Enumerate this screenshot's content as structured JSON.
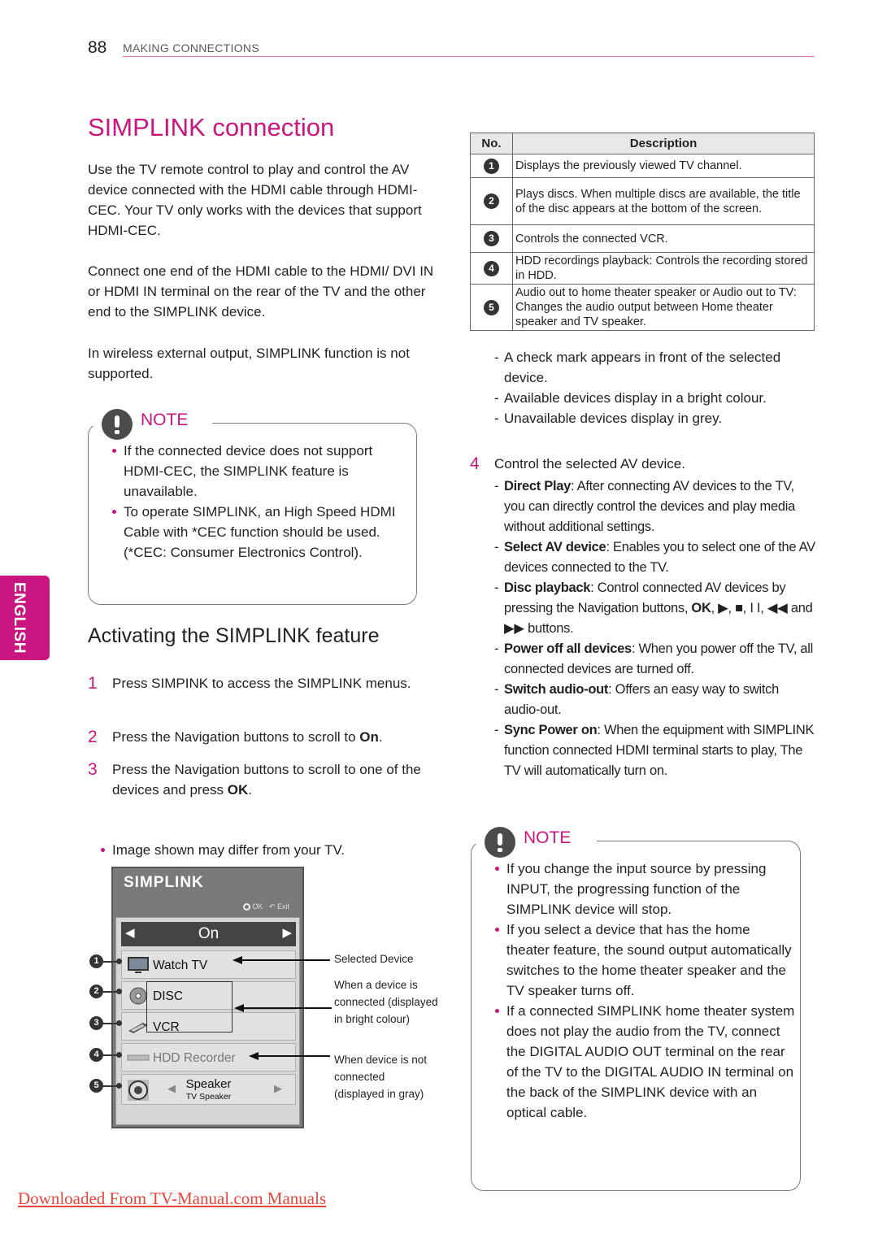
{
  "header": {
    "page_number": "88",
    "section": "MAKING CONNECTIONS"
  },
  "title": "SIMPLINK connection",
  "intro_paragraphs": [
    "Use the TV remote control to play and control the AV device connected with the HDMI cable through HDMI-CEC. Your TV only works with the devices that support HDMI-CEC.",
    "Connect one end of the HDMI cable to the HDMI/ DVI IN or HDMI IN terminal on the rear of the TV and the other end to the SIMPLINK device.",
    "In wireless external output, SIMPLINK function is not supported."
  ],
  "note1": {
    "label": "NOTE",
    "items": [
      "If the connected device does not support HDMI-CEC, the SIMPLINK feature is unavailable.",
      "To operate SIMPLINK, an High Speed HDMI Cable with *CEC function should be used. (*CEC: Consumer Electronics Control)."
    ]
  },
  "language_tab": "ENGLISH",
  "subtitle": "Activating the SIMPLINK feature",
  "steps": [
    {
      "num": "1",
      "text": "Press SIMPINK to access the SIMPLINK menus."
    },
    {
      "num": "2",
      "text_before": "Press the Navigation buttons to scroll to ",
      "bold": "On",
      "text_after": "."
    },
    {
      "num": "3",
      "text_before": "Press the Navigation buttons to scroll to one of the devices and press ",
      "bold": "OK",
      "text_after": "."
    }
  ],
  "image_note": "Image shown may differ from your TV.",
  "simplink_screen": {
    "logo": "SIMPLINK",
    "hint_ok": "OK",
    "hint_exit": "Exit",
    "mode_value": "On",
    "devices": [
      {
        "num": "1",
        "label": "Watch TV",
        "icon": "tv-icon",
        "state": "selected"
      },
      {
        "num": "2",
        "label": "DISC",
        "icon": "disc-icon",
        "state": "connected"
      },
      {
        "num": "3",
        "label": "VCR",
        "icon": "vcr-icon",
        "state": "connected"
      },
      {
        "num": "4",
        "label": "HDD Recorder",
        "icon": "hdd-icon",
        "state": "not-connected"
      },
      {
        "num": "5",
        "label": "Speaker",
        "sublabel": "TV Speaker",
        "icon": "speaker-icon",
        "state": "connected"
      }
    ],
    "legend": {
      "selected": "Selected Device",
      "connected": "When a device is connected (displayed in bright colour)",
      "not_connected": "When device is not connected (displayed in gray)"
    }
  },
  "table": {
    "headers": [
      "No.",
      "Description"
    ],
    "rows": [
      {
        "no": "1",
        "desc": "Displays the previously viewed TV channel."
      },
      {
        "no": "2",
        "desc": "Plays discs. When multiple discs are available, the title of the disc appears at the bottom of the screen."
      },
      {
        "no": "3",
        "desc": "Controls the connected VCR."
      },
      {
        "no": "4",
        "desc": "HDD recordings playback: Controls the recording stored in HDD."
      },
      {
        "no": "5",
        "desc": "Audio out to home theater speaker or Audio out to TV: Changes the audio output between Home theater speaker and TV speaker."
      }
    ]
  },
  "after_table": [
    "A check mark appears in front of the selected device.",
    "Available devices display in a bright colour.",
    "Unavailable devices display in grey."
  ],
  "step4": {
    "num": "4",
    "text": "Control the selected AV device.",
    "items": [
      {
        "term": "Direct Play",
        "desc": ": After connecting AV devices to the TV, you can directly control the devices and play media without additional settings."
      },
      {
        "term": "Select AV device",
        "desc": ": Enables you to select one of the AV devices connected to the TV."
      },
      {
        "term": "Disc playback",
        "desc": ": Control connected AV devices by pressing the Navigation buttons, ",
        "bold2": "OK",
        "desc2": ", ▶, ■, I I, ◀◀ and ▶▶ buttons."
      },
      {
        "term": "Power off all devices",
        "desc": ": When you power off the TV, all connected devices are turned off."
      },
      {
        "term": "Switch audio-out",
        "desc": ": Offers an easy way to switch audio-out."
      },
      {
        "term": "Sync Power on",
        "desc": ": When the equipment with SIMPLINK function connected HDMI terminal starts to play, The TV will automatically turn on."
      }
    ]
  },
  "note2": {
    "label": "NOTE",
    "items": [
      "If you change the input source by pressing INPUT, the progressing function of the SIMPLINK device will stop.",
      "If you select a device that has the home theater feature, the sound output automatically switches to the home theater speaker and the TV speaker turns off.",
      "If a connected SIMPLINK home theater system does not play the audio from the TV, connect the DIGITAL AUDIO OUT terminal on the rear of the TV to the DIGITAL AUDIO IN terminal on the back of the SIMPLINK device with an optical cable."
    ]
  },
  "footer_link": "Downloaded From TV-Manual.com Manuals",
  "colors": {
    "accent": "#c8167e",
    "footer_link": "#e8453c"
  }
}
